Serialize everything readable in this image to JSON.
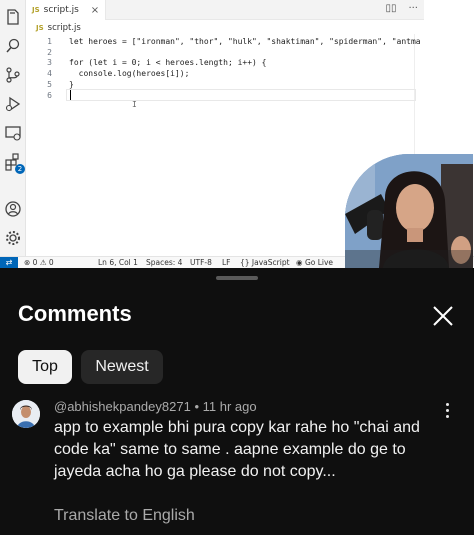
{
  "editor": {
    "tab_lang": "JS",
    "tab_filename": "script.js",
    "tab_close": "×",
    "breadcrumb_lang": "JS",
    "breadcrumb_file": "script.js",
    "lines": [
      {
        "num": "1",
        "code": "let heroes = [\"ironman\", \"thor\", \"hulk\", \"shaktiman\", \"spiderman\", \"antma"
      },
      {
        "num": "2",
        "code": ""
      },
      {
        "num": "3",
        "code": "for (let i = 0; i < heroes.length; i++) {"
      },
      {
        "num": "4",
        "code": "  console.log(heroes[i]);"
      },
      {
        "num": "5",
        "code": "}"
      },
      {
        "num": "6",
        "code": ""
      }
    ],
    "extensions_badge": "2"
  },
  "statusbar": {
    "problems": "⊗ 0 ⚠ 0",
    "cursor_pos": "Ln 6, Col 1",
    "spaces": "Spaces: 4",
    "encoding": "UTF-8",
    "eol": "LF",
    "language": "{} JavaScript",
    "go_live": "Go Live"
  },
  "comments": {
    "title": "Comments",
    "chips": {
      "top": "Top",
      "newest": "Newest"
    },
    "items": [
      {
        "author": "@abhishekpandey8271",
        "separator": "•",
        "time": "11 hr ago",
        "text": "app to example bhi pura copy kar rahe ho \"chai and code ka\" same to same . aapne example do ge to jayeda acha ho ga please do not copy...",
        "translate": "Translate to English"
      }
    ]
  },
  "colors": {
    "sheet_bg": "#0f0f0f",
    "chip_selected_bg": "#f1f1f1",
    "chip_bg": "#272727",
    "vscode_accent": "#0066b8"
  }
}
